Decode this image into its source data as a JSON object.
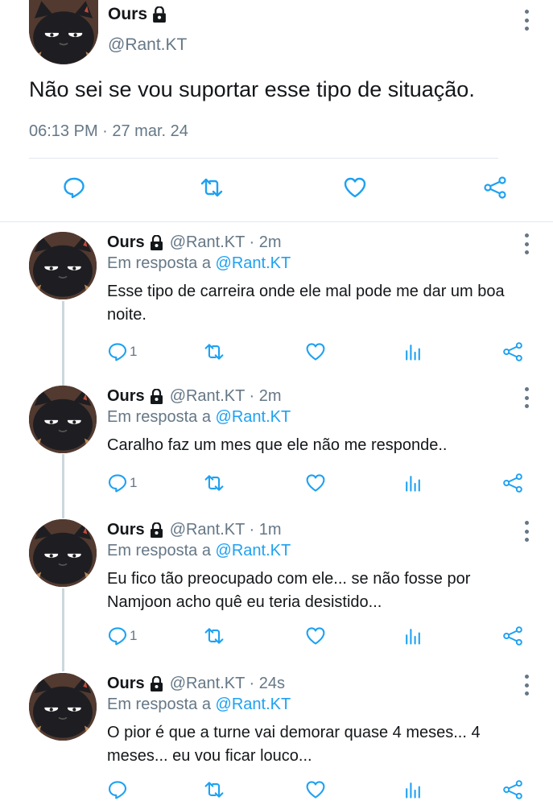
{
  "main": {
    "name": "Ours",
    "handle": "@Rant.KT",
    "text": "Não sei se vou suportar esse tipo de situação.",
    "meta": "06:13 PM · 27 mar. 24",
    "actions": [
      "reply-icon",
      "retweet-icon",
      "like-icon",
      "share-icon"
    ]
  },
  "replies": [
    {
      "name": "Ours",
      "handle_time": "@Rant.KT · 2m",
      "replying_prefix": "Em resposta a",
      "replying_to": "@Rant.KT",
      "text": "Esse tipo de carreira onde ele mal pode me dar um boa noite.",
      "reply_count": "1"
    },
    {
      "name": "Ours",
      "handle_time": "@Rant.KT · 2m",
      "replying_prefix": "Em resposta a",
      "replying_to": "@Rant.KT",
      "text": "Caralho faz um mes que ele não me responde..",
      "reply_count": "1"
    },
    {
      "name": "Ours",
      "handle_time": "@Rant.KT · 1m",
      "replying_prefix": "Em resposta a",
      "replying_to": "@Rant.KT",
      "text": "Eu fico tão preocupado com ele... se não fosse por Namjoon acho quê eu teria desistido...",
      "reply_count": "1"
    },
    {
      "name": "Ours",
      "handle_time": "@Rant.KT · 24s",
      "replying_prefix": "Em resposta a",
      "replying_to": "@Rant.KT",
      "text": "O pior é que a turne vai demorar quase 4 meses... 4 meses... eu vou ficar louco...",
      "reply_count": ""
    }
  ],
  "colors": {
    "accent": "#1da1f2",
    "icon_gray": "#657786",
    "text": "#14171a",
    "divider": "#e1e8ed"
  }
}
